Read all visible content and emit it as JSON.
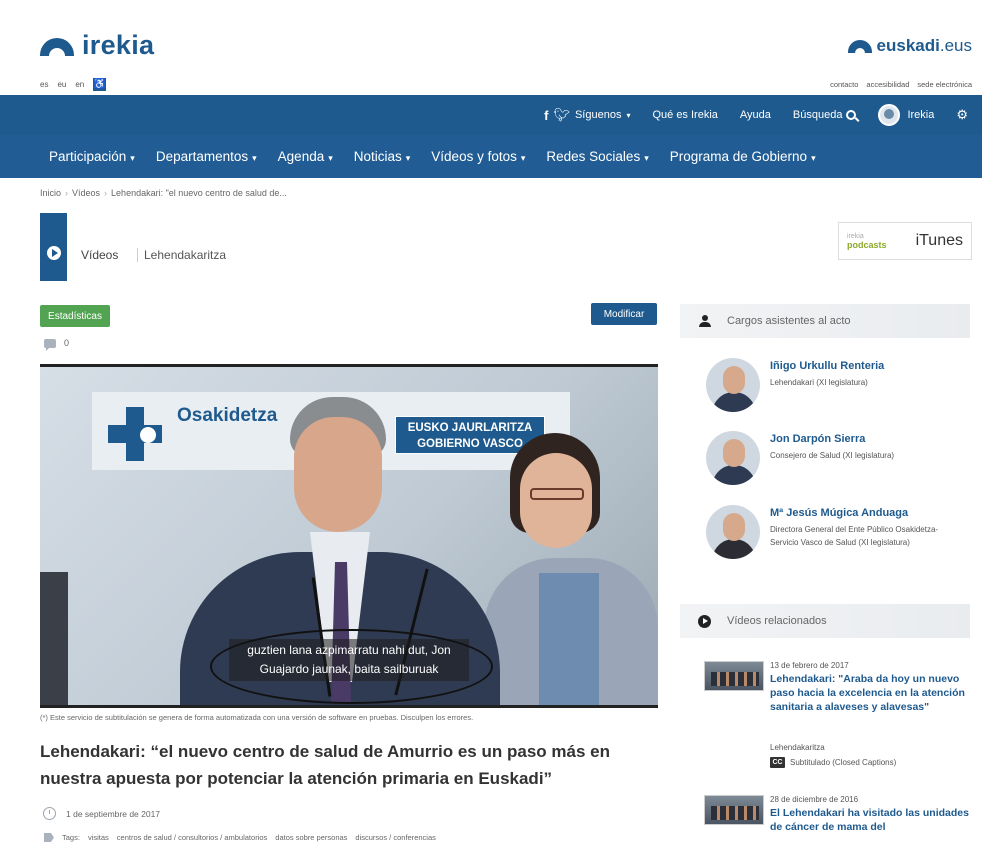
{
  "header": {
    "logo_text": "irekia",
    "euskadi_bold": "euskadi",
    "euskadi_tld": ".eus",
    "langs": [
      "es",
      "eu",
      "en"
    ],
    "top_links": [
      "contacto",
      "accesibilidad",
      "sede electrónica"
    ]
  },
  "utility_bar": {
    "follow_label": "Síguenos",
    "what_is": "Qué es Irekia",
    "help": "Ayuda",
    "search": "Búsqueda",
    "user": "Irekia"
  },
  "nav": {
    "items": [
      "Participación",
      "Departamentos",
      "Agenda",
      "Noticias",
      "Vídeos y fotos",
      "Redes Sociales",
      "Programa de Gobierno"
    ]
  },
  "breadcrumb": [
    "Inicio",
    "Vídeos",
    "Lehendakari: \"el nuevo centro de salud de..."
  ],
  "section": {
    "title": "Vídeos",
    "subtitle": "Lehendakaritza"
  },
  "podcasts": {
    "top": "irekia",
    "label": "podcasts",
    "itunes": "iTunes"
  },
  "actions": {
    "stats": "Estadísticas",
    "modify": "Modificar",
    "comments_count": "0"
  },
  "video": {
    "org": "Osakidetza",
    "gov_line1": "EUSKO JAURLARITZA",
    "gov_line2": "GOBIERNO VASCO",
    "subtitle_text": "guztien lana azpimarratu nahi dut, Jon Guajardo jaunak, baita sailburuak"
  },
  "article": {
    "disclaimer": "(*) Este servicio de subtitulación se genera de forma automatizada con una versión de software en pruebas. Disculpen los errores.",
    "title": "Lehendakari: “el nuevo centro de salud de Amurrio es un paso más en nuestra apuesta por potenciar la atención primaria en Euskadi”",
    "date": "1 de septiembre de 2017",
    "tags_label": "Tags:",
    "tags": [
      "visitas",
      "centros de salud / consultorios / ambulatorios",
      "datos sobre personas",
      "discursos / conferencias"
    ]
  },
  "sidebar": {
    "attendees_title": "Cargos asistentes al acto",
    "people": [
      {
        "name": "Iñigo Urkullu Renteria",
        "role": "Lehendakari (XI legislatura)"
      },
      {
        "name": "Jon Darpón Sierra",
        "role": "Consejero de Salud (XI legislatura)"
      },
      {
        "name": "Mª Jesús Múgica Anduaga",
        "role": "Directora General del Ente Público Osakidetza-Servicio Vasco de Salud (XI legislatura)"
      }
    ],
    "related_title": "Vídeos relacionados",
    "related": [
      {
        "date": "13 de febrero de 2017",
        "title": "Lehendakari: \"Araba da hoy un nuevo paso hacia la excelencia en la atención sanitaria a alaveses y alavesas\"",
        "source": "Lehendakaritza",
        "cc": "Subtitulado (Closed Captions)"
      },
      {
        "date": "28 de diciembre de 2016",
        "title": "El Lehendakari ha visitado las unidades de cáncer de mama del"
      }
    ]
  },
  "colors": {
    "brand_blue": "#1e5a8e",
    "nav_blue": "#215d94",
    "stats_green": "#53a452"
  }
}
